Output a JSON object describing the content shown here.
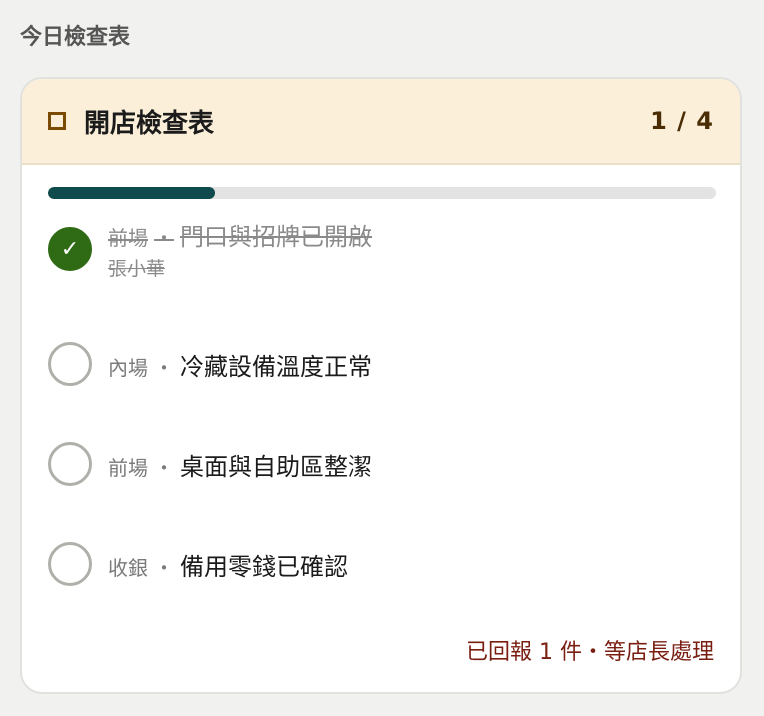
{
  "section": {
    "title": "今日檢查表"
  },
  "checklist": {
    "title": "開店檢查表",
    "count": "1 / 4",
    "progress": 0.25,
    "colors": {
      "header_bg": "#fbefda",
      "progress": "#0f4a4c",
      "done": "#2f6a15",
      "status": "#7a1e12"
    },
    "items": [
      {
        "area": "前場",
        "sep": "・",
        "task": "門口與招牌已開啟",
        "done": true,
        "by": "張小華",
        "check_mark": "✓"
      },
      {
        "area": "內場",
        "sep": "・",
        "task": "冷藏設備溫度正常",
        "done": false
      },
      {
        "area": "前場",
        "sep": "・",
        "task": "桌面與自助區整潔",
        "done": false
      },
      {
        "area": "收銀",
        "sep": "・",
        "task": "備用零錢已確認",
        "done": false
      }
    ],
    "status": "已回報 1 件・等店長處理"
  }
}
